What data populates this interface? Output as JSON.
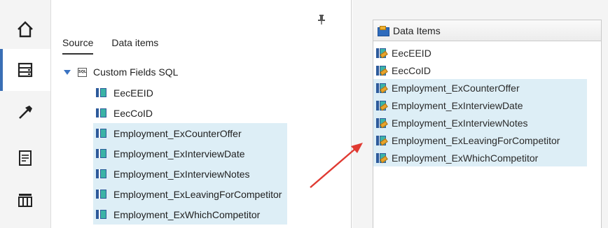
{
  "nav": {
    "items": [
      {
        "icon": "home-icon"
      },
      {
        "icon": "data-source-icon",
        "active": true
      },
      {
        "icon": "hammer-icon"
      },
      {
        "icon": "page-icon"
      },
      {
        "icon": "table-icon"
      }
    ]
  },
  "source_panel": {
    "tabs": [
      {
        "label": "Source",
        "active": true
      },
      {
        "label": "Data items",
        "active": false
      }
    ],
    "tree": {
      "root_icon_text": "SQL",
      "root_label": "Custom Fields SQL",
      "items": [
        {
          "label": "EecEEID",
          "selected": false
        },
        {
          "label": "EecCoID",
          "selected": false
        },
        {
          "label": "Employment_ExCounterOffer",
          "selected": true
        },
        {
          "label": "Employment_ExInterviewDate",
          "selected": true
        },
        {
          "label": "Employment_ExInterviewNotes",
          "selected": true
        },
        {
          "label": "Employment_ExLeavingForCompetitor",
          "selected": true
        },
        {
          "label": "Employment_ExWhichCompetitor",
          "selected": true
        }
      ]
    }
  },
  "data_items_panel": {
    "header": "Data Items",
    "items": [
      {
        "label": "EecEEID",
        "selected": false
      },
      {
        "label": "EecCoID",
        "selected": false
      },
      {
        "label": "Employment_ExCounterOffer",
        "selected": true
      },
      {
        "label": "Employment_ExInterviewDate",
        "selected": true
      },
      {
        "label": "Employment_ExInterviewNotes",
        "selected": true
      },
      {
        "label": "Employment_ExLeavingForCompetitor",
        "selected": true
      },
      {
        "label": "Employment_ExWhichCompetitor",
        "selected": true
      }
    ]
  },
  "colors": {
    "selection": "#ddeef6",
    "accent": "#3a6fb5",
    "arrow": "#e03a32"
  }
}
